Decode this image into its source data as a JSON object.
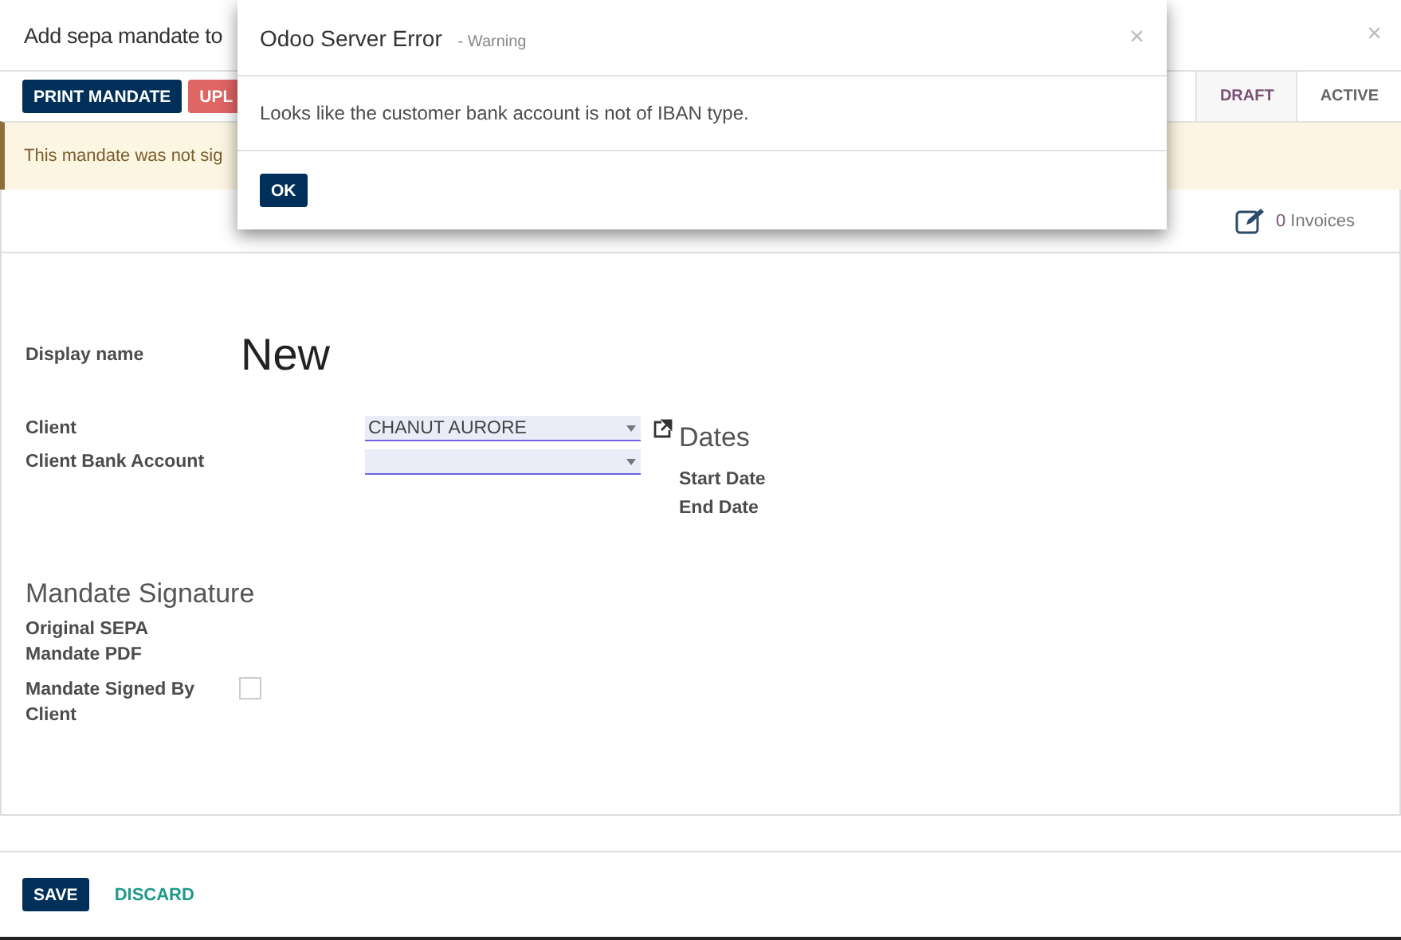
{
  "window": {
    "title": "Add sepa mandate to",
    "close_glyph": "×"
  },
  "toolbar": {
    "buttons": [
      {
        "label": "PRINT MANDATE",
        "kind": "primary"
      },
      {
        "label": "UPL",
        "kind": "danger"
      }
    ],
    "statusbar": [
      {
        "label": "DRAFT",
        "selected": true
      },
      {
        "label": "ACTIVE",
        "selected": false
      }
    ]
  },
  "alert": {
    "text": "This mandate was not sig"
  },
  "smart_button": {
    "count": "0",
    "label": "Invoices"
  },
  "form": {
    "display_name": {
      "label": "Display name",
      "value": "New"
    },
    "fields": [
      {
        "label": "Client",
        "value": "CHANUT AURORE",
        "external_link": true
      },
      {
        "label": "Client Bank Account",
        "external_link": false
      }
    ],
    "dates": {
      "title": "Dates",
      "fields": [
        {
          "label": "Start Date"
        },
        {
          "label": "End Date"
        }
      ]
    },
    "signature": {
      "title": "Mandate Signature",
      "fields": [
        {
          "label": "Original SEPA Mandate PDF",
          "kind": "file"
        },
        {
          "label": "Mandate Signed By Client",
          "kind": "checkbox",
          "checked": false
        }
      ]
    }
  },
  "footer": {
    "buttons": [
      {
        "label": "SAVE",
        "kind": "primary"
      },
      {
        "label": "DISCARD",
        "kind": "link"
      }
    ]
  },
  "dialog": {
    "title": "Odoo Server Error",
    "subtitle": "- Warning",
    "close_glyph": "×",
    "message": "Looks like the customer bank account is not of IBAN type.",
    "button": "OK"
  }
}
